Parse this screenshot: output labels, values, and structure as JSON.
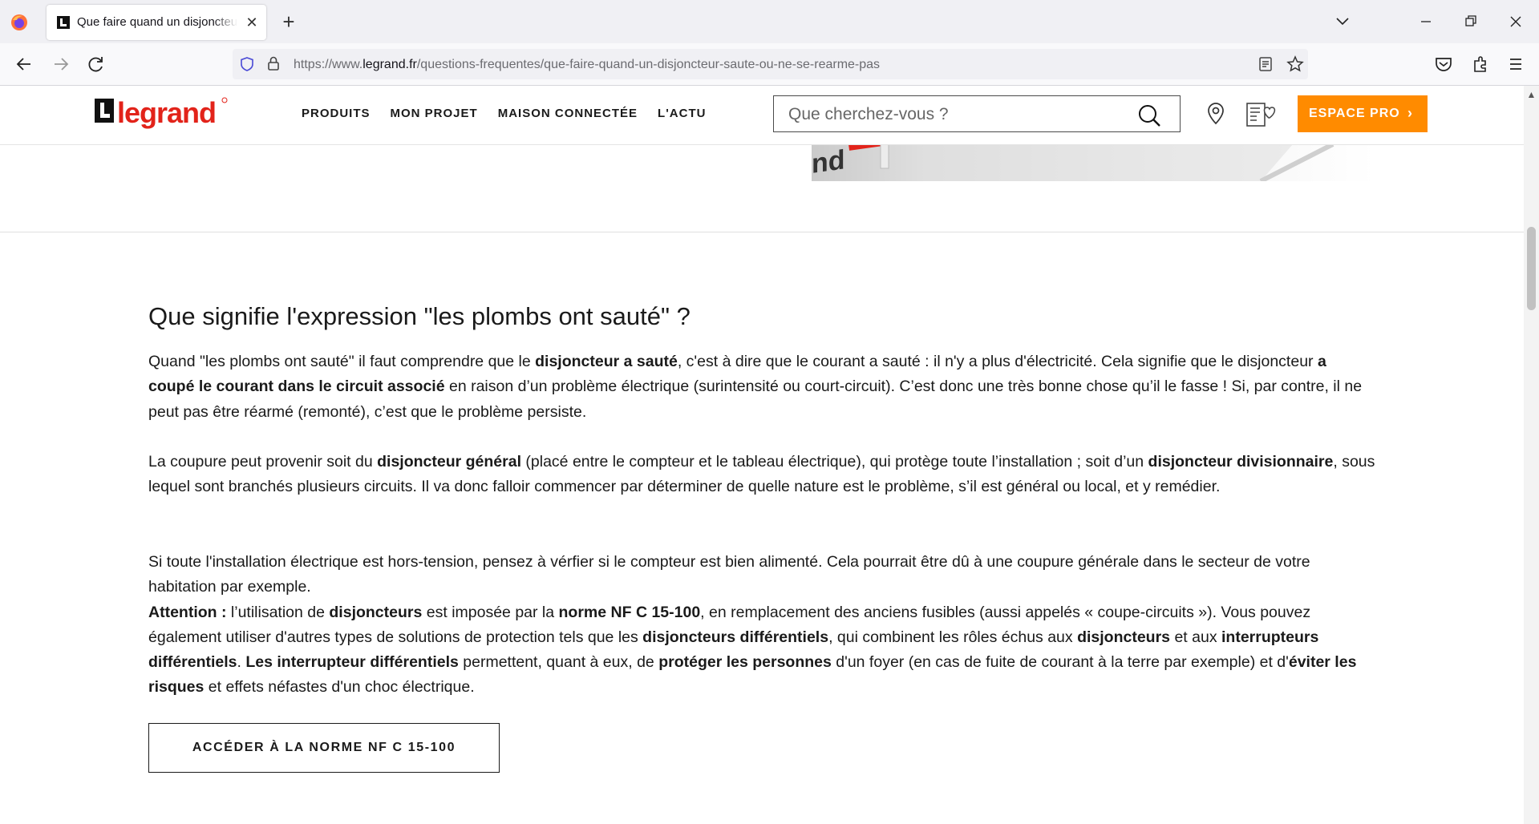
{
  "browser": {
    "tab_title": "Que faire quand un disjoncteur saute ou ne se réarme pas",
    "url_prefix": "https://www.",
    "url_domain": "legrand.fr",
    "url_path": "/questions-frequentes/que-faire-quand-un-disjoncteur-saute-ou-ne-se-rearme-pas"
  },
  "header": {
    "logo_text": "legrand",
    "menu": [
      "PRODUITS",
      "MON PROJET",
      "MAISON CONNECTÉE",
      "L'ACTU"
    ],
    "search_placeholder": "Que cherchez-vous ?",
    "pro_button": "ESPACE PRO",
    "accent_color": "#ff8b00",
    "brand_color": "#e2231a"
  },
  "article": {
    "heading": "Que signifie l'expression \"les plombs ont sauté\" ?",
    "p1": [
      {
        "t": "Quand \"les plombs ont sauté\" il faut comprendre que le "
      },
      {
        "t": "disjoncteur a sauté",
        "b": true
      },
      {
        "t": ", c'est à dire que le courant a sauté : il n'y a plus d'électricité. Cela signifie que le disjoncteur "
      },
      {
        "t": "a coupé le courant dans le circuit associé",
        "b": true
      },
      {
        "t": " en raison d’un problème électrique (surintensité ou court-circuit). C’est donc une très bonne chose qu’il le fasse ! Si, par contre, il ne peut pas être réarmé (remonté), c’est que le problème persiste."
      }
    ],
    "p2": [
      {
        "t": "La coupure peut provenir soit du "
      },
      {
        "t": "disjoncteur général",
        "b": true
      },
      {
        "t": " (placé entre le compteur et le tableau électrique), qui protège toute l’installation ; soit d’un "
      },
      {
        "t": "disjoncteur divisionnaire",
        "b": true
      },
      {
        "t": ", sous lequel sont branchés plusieurs circuits. Il va donc falloir commencer par déterminer de quelle nature est le problème, s’il est général ou local, et y remédier."
      }
    ],
    "p3": [
      {
        "t": "Si toute l'installation électrique est hors-tension, pensez à vérfier si le compteur est bien alimenté. Cela pourrait être dû à une coupure générale dans le secteur de votre habitation par exemple."
      },
      {
        "br": true
      },
      {
        "t": "Attention :",
        "b": true
      },
      {
        "t": " l’utilisation de "
      },
      {
        "t": "disjoncteurs",
        "b": true
      },
      {
        "t": " est imposée par la "
      },
      {
        "t": "norme NF C 15-100",
        "b": true
      },
      {
        "t": ", en remplacement des anciens fusibles (aussi appelés « coupe-circuits »). Vous pouvez également utiliser d'autres types de solutions de protection tels que les "
      },
      {
        "t": "disjoncteurs différentiels",
        "b": true
      },
      {
        "t": ", qui combinent les rôles échus aux "
      },
      {
        "t": "disjoncteurs",
        "b": true
      },
      {
        "t": " et aux "
      },
      {
        "t": "interrupteurs différentiels",
        "b": true
      },
      {
        "t": ". "
      },
      {
        "t": "Les interrupteur différentiels",
        "b": true
      },
      {
        "t": " permettent, quant à eux, de "
      },
      {
        "t": "protéger les personnes",
        "b": true
      },
      {
        "t": " d'un foyer (en cas de fuite de courant à la terre par exemple) et d'"
      },
      {
        "t": "éviter les risques",
        "b": true
      },
      {
        "t": " et effets néfastes d'un choc électrique."
      }
    ],
    "button": "ACCÉDER À LA NORME NF C 15-100"
  }
}
